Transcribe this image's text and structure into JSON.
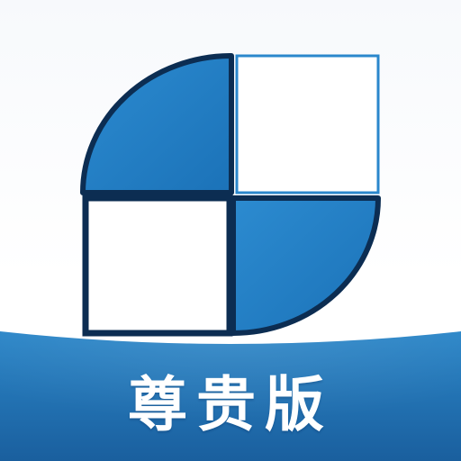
{
  "app_icon": {
    "edition_label": "尊贵版",
    "logo_icon": "four-quadrant-leaf-icon"
  },
  "colors": {
    "primary_blue": "#2a87cc",
    "deep_blue": "#1b6aae",
    "outline_navy": "#0c2d52",
    "white": "#ffffff",
    "banner_light": "#2b86c8",
    "banner_dark": "#1a5f9e"
  }
}
